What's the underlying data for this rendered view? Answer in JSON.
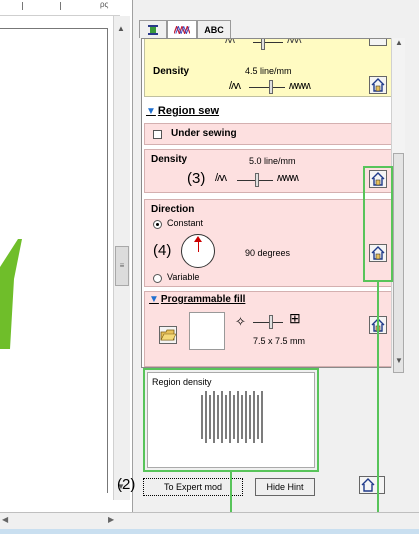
{
  "canvas": {
    "ruler_label": "ρς"
  },
  "tabs": [
    {
      "icon": "thread-spool-icon",
      "label": ""
    },
    {
      "icon": "stitch-pattern-icon",
      "label": ""
    },
    {
      "icon": "text-tab-icon",
      "label": "ABC"
    }
  ],
  "top_section": {
    "density_label": "Density",
    "density_value": "4.5 line/mm"
  },
  "region_sew": {
    "title": "Region sew",
    "under_sewing_label": "Under sewing",
    "density_label": "Density",
    "density_value": "5.0 line/mm",
    "direction_label": "Direction",
    "constant_label": "Constant",
    "degrees_value": "90 degrees",
    "variable_label": "Variable"
  },
  "programmable_fill": {
    "title": "Programmable fill",
    "size_value": "7.5 x 7.5 mm"
  },
  "hint": {
    "title": "Region density"
  },
  "buttons": {
    "expert_mode": "To Expert mod",
    "hide_hint": "Hide Hint"
  },
  "annotations": {
    "a2": "(2)",
    "a3": "(3)",
    "a4": "(4)"
  },
  "colors": {
    "highlight": "#58c45a",
    "yellow_panel": "#fffbc2",
    "pink_panel": "#fde0e0",
    "accent_blue": "#1f6fcf",
    "shape_green": "#6fbe2a"
  }
}
